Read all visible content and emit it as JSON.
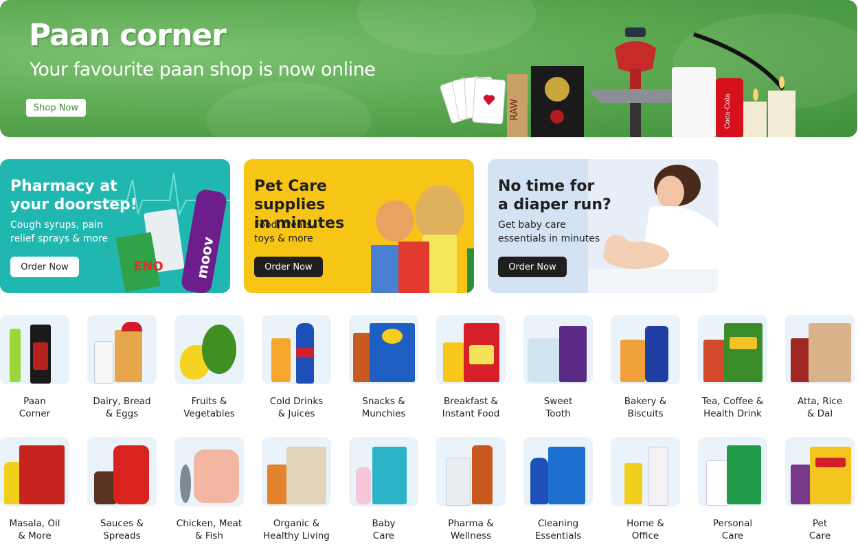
{
  "hero": {
    "title": "Paan corner",
    "subtitle": "Your favourite paan shop is now online",
    "button": "Shop Now"
  },
  "promos": [
    {
      "title": "Pharmacy at\nyour doorstep!",
      "subtitle": "Cough syrups, pain\nrelief sprays & more",
      "button": "Order Now",
      "bg": "#1fb7b0",
      "text_color": "#ffffff"
    },
    {
      "title": "Pet Care supplies\nin minutes",
      "subtitle": "Food, treats,\ntoys & more",
      "button": "Order Now",
      "bg": "#f7c516",
      "text_color": "#1f1f1f"
    },
    {
      "title": "No time for\na diaper run?",
      "subtitle": "Get baby care\nessentials in minutes",
      "button": "Order Now",
      "bg": "#d3e3f4",
      "text_color": "#1f1f1f"
    }
  ],
  "categories_row1": [
    {
      "label": "Paan\nCorner"
    },
    {
      "label": "Dairy, Bread\n& Eggs"
    },
    {
      "label": "Fruits &\nVegetables"
    },
    {
      "label": "Cold Drinks\n& Juices"
    },
    {
      "label": "Snacks &\nMunchies"
    },
    {
      "label": "Breakfast &\nInstant Food"
    },
    {
      "label": "Sweet\nTooth"
    },
    {
      "label": "Bakery &\nBiscuits"
    },
    {
      "label": "Tea, Coffee &\nHealth Drink"
    },
    {
      "label": "Atta, Rice\n& Dal"
    }
  ],
  "categories_row2": [
    {
      "label": "Masala, Oil\n& More"
    },
    {
      "label": "Sauces &\nSpreads"
    },
    {
      "label": "Chicken, Meat\n& Fish"
    },
    {
      "label": "Organic &\nHealthy Living"
    },
    {
      "label": "Baby\nCare"
    },
    {
      "label": "Pharma &\nWellness"
    },
    {
      "label": "Cleaning\nEssentials"
    },
    {
      "label": "Home &\nOffice"
    },
    {
      "label": "Personal\nCare"
    },
    {
      "label": "Pet\nCare"
    }
  ],
  "colors": {
    "hero_green": "#58a64e",
    "button_dark": "#1f1f1f",
    "tile_bg": "#eaf3fa"
  }
}
